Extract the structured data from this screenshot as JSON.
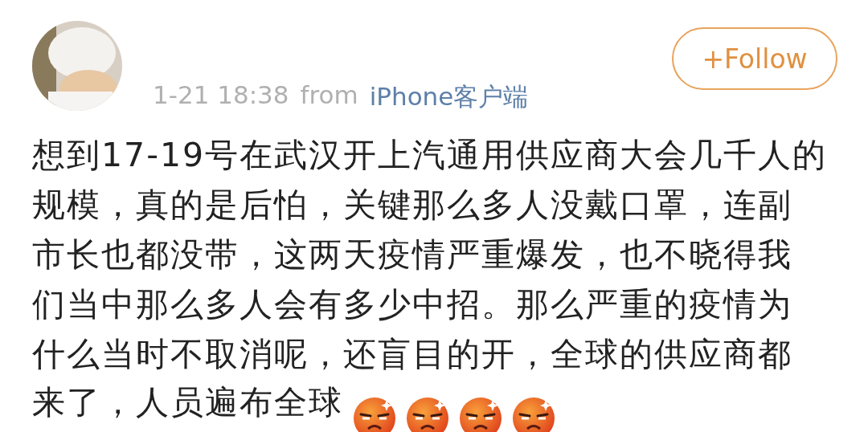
{
  "post": {
    "time": "1-21 18:38",
    "source_prefix": "from",
    "source": "iPhone客户端",
    "follow_button": "+Follow",
    "lines": [
      "想到17-19号在武汉开上汽通用供应商大会几千人的",
      "规模，真的是后怕，关键那么多人没戴口罩，连副",
      "市长也都没带，这两天疫情严重爆发，也不晓得我",
      "们当中那么多人会有多少中招。那么严重的疫情为",
      "什么当时不取消呢，还盲目的开，全球的供应商都"
    ],
    "last_line": "来了，人员遍布全球",
    "emojis": [
      {
        "kind": "angry"
      },
      {
        "kind": "angry"
      },
      {
        "kind": "angry"
      },
      {
        "kind": "angry"
      }
    ]
  }
}
